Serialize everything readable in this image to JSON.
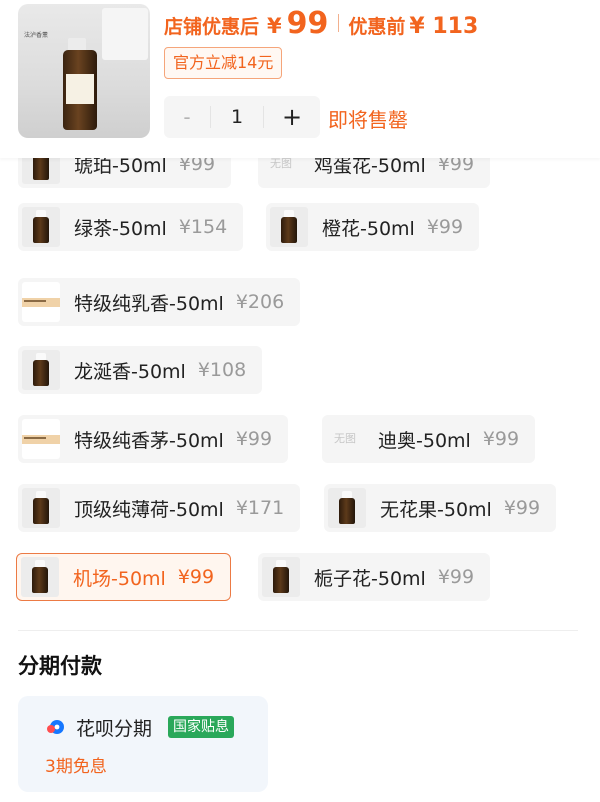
{
  "header": {
    "thumb_card_text": "法泸香薰",
    "after_label": "店铺优惠后",
    "after_yen": "¥",
    "after_price": "99",
    "before_label": "优惠前",
    "before_price": "¥ 113",
    "coupon": "官方立减14元",
    "qty_minus": "-",
    "qty_value": "1",
    "qty_plus": "+",
    "stock_status": "即将售罄"
  },
  "options": [
    {
      "name": "琥珀-50ml",
      "price": "¥99",
      "image": "bottle"
    },
    {
      "name": "鸡蛋花-50ml",
      "price": "¥99",
      "image": "none",
      "noimg_text": "无图"
    },
    {
      "name": "绿茶-50ml",
      "price": "¥154",
      "image": "bottle"
    },
    {
      "name": "橙花-50ml",
      "price": "¥99",
      "image": "bottle"
    },
    {
      "name": "特级纯乳香-50ml",
      "price": "¥206",
      "image": "label"
    },
    {
      "name": "龙涎香-50ml",
      "price": "¥108",
      "image": "bottle"
    },
    {
      "name": "特级纯香茅-50ml",
      "price": "¥99",
      "image": "label"
    },
    {
      "name": "迪奥-50ml",
      "price": "¥99",
      "image": "none",
      "noimg_text": "无图"
    },
    {
      "name": "顶级纯薄荷-50ml",
      "price": "¥171",
      "image": "bottle"
    },
    {
      "name": "无花果-50ml",
      "price": "¥99",
      "image": "bottle"
    },
    {
      "name": "机场-50ml",
      "price": "¥99",
      "image": "bottle",
      "selected": true
    },
    {
      "name": "栀子花-50ml",
      "price": "¥99",
      "image": "bottle"
    }
  ],
  "payment": {
    "title": "分期付款",
    "method_icon": "huabei-icon",
    "method_name": "花呗分期",
    "badge": "国家贴息",
    "free_label": "3期免息"
  },
  "colors": {
    "accent": "#f2641e",
    "selected_border": "#ec7a44",
    "badge_green": "#2aa85a",
    "chip_bg": "#f5f5f5"
  }
}
